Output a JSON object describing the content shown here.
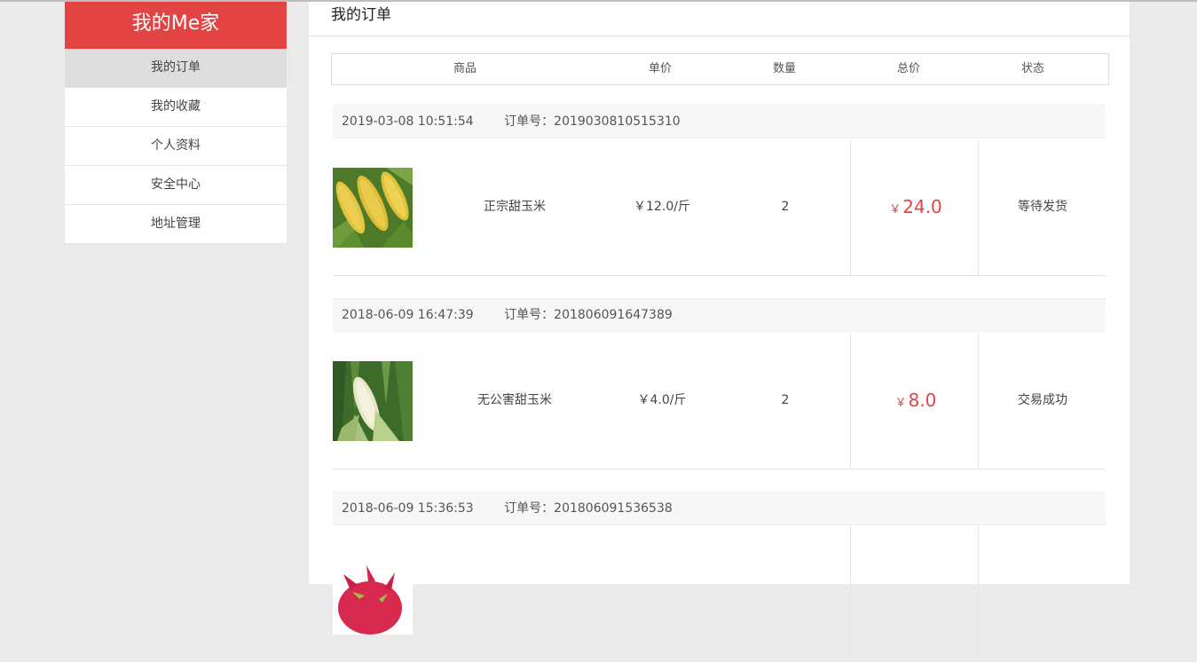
{
  "sidebar": {
    "brand": "我的Me家",
    "items": [
      {
        "label": "我的订单",
        "active": true
      },
      {
        "label": "我的收藏",
        "active": false
      },
      {
        "label": "个人资料",
        "active": false
      },
      {
        "label": "安全中心",
        "active": false
      },
      {
        "label": "地址管理",
        "active": false
      }
    ]
  },
  "main": {
    "title": "我的订单",
    "columns": [
      "商品",
      "单价",
      "数量",
      "总价",
      "状态"
    ],
    "orders": [
      {
        "date": "2019-03-08 10:51:54",
        "order_no": "订单号：2019030810515310",
        "product": "正宗甜玉米",
        "unit_price": "￥12.0/斤",
        "qty": "2",
        "currency": "￥",
        "total": "24.0",
        "status": "等待发货",
        "image_icon": "yellow-corn-photo"
      },
      {
        "date": "2018-06-09 16:47:39",
        "order_no": "订单号：201806091647389",
        "product": "无公害甜玉米",
        "unit_price": "￥4.0/斤",
        "qty": "2",
        "currency": "￥",
        "total": "8.0",
        "status": "交易成功",
        "image_icon": "white-corn-photo"
      },
      {
        "date": "2018-06-09 15:36:53",
        "order_no": "订单号：201806091536538",
        "image_icon": "dragon-fruit-photo"
      }
    ]
  },
  "colors": {
    "accent": "#e24444",
    "background": "#ebebeb"
  }
}
